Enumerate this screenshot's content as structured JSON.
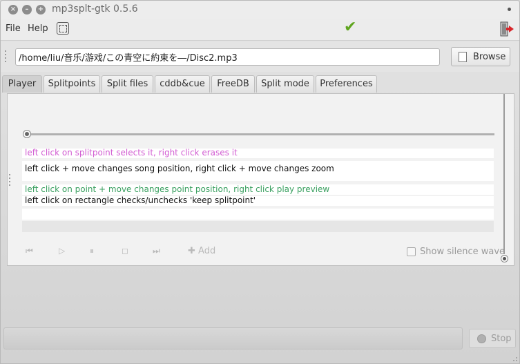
{
  "window": {
    "title": "mp3splt-gtk 0.5.6",
    "close_glyph": "×",
    "minimize_glyph": "–",
    "maximize_glyph": "+"
  },
  "menubar": {
    "file": "File",
    "help": "Help",
    "icons": [
      "fullscreen-icon",
      "check-icon",
      "exit-icon"
    ],
    "check_color": "#5fa51e",
    "exit_arrow_color": "#d7262b"
  },
  "path": {
    "value": "/home/liu/音乐/游戏/この青空に約束を―/Disc2.mp3",
    "browse_label": "Browse"
  },
  "tabs": [
    {
      "label": "Player",
      "active": true
    },
    {
      "label": "Splitpoints"
    },
    {
      "label": "Split files"
    },
    {
      "label": "cddb&cue"
    },
    {
      "label": "FreeDB"
    },
    {
      "label": "Split mode"
    },
    {
      "label": "Preferences"
    }
  ],
  "player": {
    "hints": [
      "left click on splitpoint selects it, right click erases it",
      "left click + move changes song position, right click + move changes zoom",
      "left click on point + move changes point position, right click play preview",
      "left click on rectangle checks/unchecks 'keep splitpoint'"
    ],
    "hint_colors": {
      "pink": "#d25cd2",
      "green": "#3aa060"
    },
    "controls": {
      "previous_icon": "⏮",
      "play_icon": "▷",
      "pause_icon": "⏸",
      "stop_icon": "◻",
      "next_icon": "⏭",
      "add_icon": "✚",
      "add_label": "Add"
    },
    "silence_wave_label": "Show silence wave"
  },
  "bottom": {
    "stop_label": "Stop"
  }
}
